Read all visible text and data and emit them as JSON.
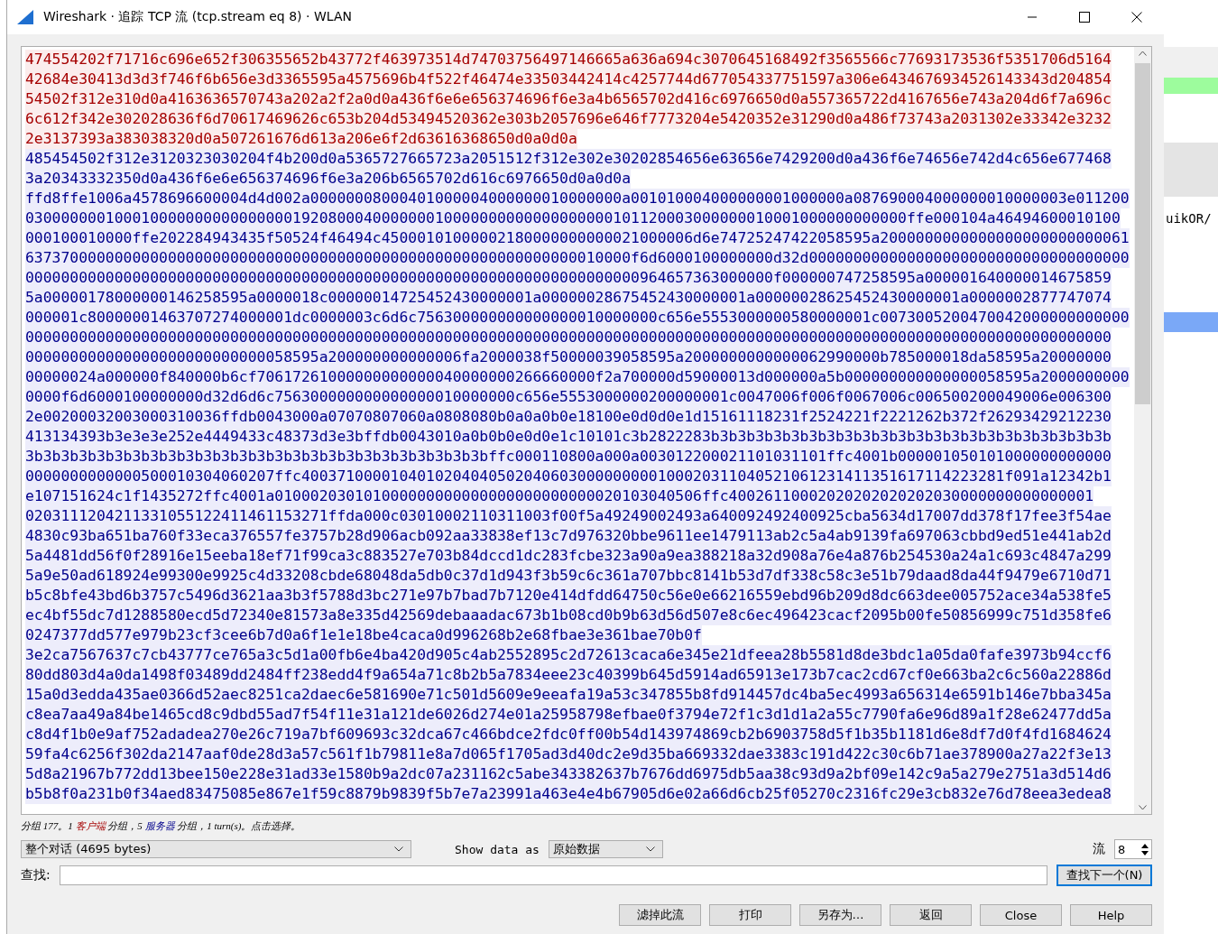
{
  "window": {
    "title": "Wireshark · 追踪 TCP 流 (tcp.stream eq 8) · WLAN"
  },
  "background_window": {
    "text": "uikOR/"
  },
  "stream": [
    {
      "kind": "client",
      "lines": [
        "474554202f71716c696e652f306355652b43772f463973514d74703756497146665a636a694c3070645168492f3565566c77693173536f5351706d5164",
        "42684e30413d3d3f746f6b656e3d3365595a4575696b4f522f46474e33503442414c4257744d677054337751597a306e6434676934526143343d204854",
        "54502f312e310d0a4163636570743a202a2f2a0d0a436f6e6e656374696f6e3a4b6565702d416c6976650d0a557365722d4167656e743a204d6f7a696c",
        "6c612f342e302028636f6d70617469626c653b204d53494520362e303b2057696e646f7773204e5420352e31290d0a486f73743a2031302e33342e3232",
        "2e3137393a383038320d0a507261676d613a206e6f2d63616368650d0a0d0a"
      ]
    },
    {
      "kind": "server",
      "lines": [
        "485454502f312e3120323030204f4b200d0a5365727665723a2051512f312e302e30202854656e63656e7429200d0a436f6e74656e742d4c656e677468",
        "3a20343332350d0a436f6e6e656374696f6e3a206b6565702d616c6976650d0a0d0a"
      ]
    },
    {
      "kind": "server",
      "lines": [
        "ffd8ffe1006a4578696600004d4d002a00000008000401000004000000010000000a001010004000000001000000a087690004000000010000003e011200",
        "030000000100010000000000000000192080004000000010000000000000000000101120003000000010001000000000000ffe000104a46494600010100",
        "000100010000ffe202284943435f50524f46494c45000101000002180000000000021000006d6e74725247422058595a2000000000000000000000000061",
        "63737000000000000000000000000000000000000000000000000000000000010000f6d6000100000000d32d000000000000000000000000000000000000",
        "000000000000000000000000000000000000000000000000000000000000000000000964657363000000f000000747258595a000001640000014675859",
        "5a00000178000000146258595a0000018c00000014725452430000001a00000028675452430000001a00000028625452430000001a0000002877747074",
        "000001c80000001463707274000001dc0000003c6d6c756300000000000000010000000c656e5553000000580000001c0073005200470042000000000000",
        "00000000000000000000000000000000000000000000000000000000000000000000000000000000000000000000000000000000000000000000000000",
        "000000000000000000000000000058595a200000000000006fa2000038f50000039058595a2000000000000062990000b785000018da58595a20000000",
        "00000024a000000f840000b6cf70617261000000000000040000000266660000f2a700000d59000013d000000a5b000000000000000058595a2000000000",
        "0000f6d6000100000000d32d6d6c756300000000000000010000000c656e5553000000200000001c0047006f006f0067006c006500200049006e006300",
        "2e00200032003000310036ffdb0043000a07070807060a0808080b0a0a0b0e18100e0d0d0e1d15161118231f2524221f2221262b372f26293429212230",
        "413134393b3e3e3e252e4449433c48373d3e3bffdb0043010a0b0b0e0d0e1c10101c3b2822283b3b3b3b3b3b3b3b3b3b3b3b3b3b3b3b3b3b3b3b3b3b3b",
        "3b3b3b3b3b3b3b3b3b3b3b3b3b3b3b3b3b3b3b3b3b3b3b3b3b3bffc000110800a000a003012200021101031101ffc4001b000001050101000000000000",
        "0000000000000500010304060207ffc4003710000104010204040502040603000000000100020311040521061231411351617114223281f091a12342b1",
        "e107151624c1f1435272ffc4001a010002030101000000000000000000000000020103040506ffc40026110002020202020202030000000000000001",
        "0203111204211331055122411461153271ffda000c03010002110311003f00f5a49249002493a640092492400925cba5634d17007dd378f17fee3f54ae",
        "4830c93ba651ba760f33eca376557fe3757b28d906acb092aa33838ef13c7d976320bbe9611ee1479113ab2c5a4ab9139fa697063cbbd9ed51e441ab2d",
        "5a4481dd56f0f28916e15eeba18ef71f99ca3c883527e703b84dccd1dc283fcbe323a90a9ea388218a32d908a76e4a876b254530a24a1c693c4847a299",
        "5a9e50ad618924e99300e9925c4d33208cbde68048da5db0c37d1d943f3b59c6c361a707bbc8141b53d7df338c58c3e51b79daad8da44f9479e6710d71",
        "b5c8bfe43bd6b3757c5496d3621aa3b3f5788d3bc271e97b7bad7b7120e414dfdd64750c56e0e66216559ebd96b209d8dc663dee005752ace34a538fe5",
        "ec4bf55dc7d1288580ecd5d72340e81573a8e335d42569debaaadac673b1b08cd0b9b63d56d507e8c6ec496423cacf2095b00fe50856999c751d358fe6",
        "0247377dd577e979b23cf3cee6b7d0a6f1e1e18be4caca0d996268b2e68fbae3e361bae70b0f"
      ]
    },
    {
      "kind": "server",
      "lines": [
        "3e2ca7567637c7cb43777ce765a3c5d1a00fb6e4ba420d905c4ab2552895c2d72613caca6e345e21dfeea28b5581d8de3bdc1a05da0fafe3973b94ccf6",
        "80dd803d4a0da1498f03489dd2484ff238edd4f9a654a71c8b2b5a7834eee23c40399b645d5914ad65913e173b7cac2cd67cf0e663ba2c6c560a22886d",
        "15a0d3edda435ae0366d52aec8251ca2daec6e581690e71c501d5609e9eeafa19a53c347855b8fd914457dc4ba5ec4993a656314e6591b146e7bba345a",
        "c8ea7aa49a84be1465cd8c9dbd55ad7f54f11e31a121de6026d274e01a25958798efbae0f3794e72f1c3d1d1a2a55c7790fa6e96d89a1f28e62477dd5a",
        "c8d4f1b0e9af752adadea270e26c719a7bf609693c32dca67c466bdce2fdc0ff00b54d143974869cb2b6903758d5f1b35b1181d6e8df7d0f4fd1684624",
        "59fa4c6256f302da2147aaf0de28d3a57c561f1b79811e8a7d065f1705ad3d40dc2e9d35ba669332dae3383c191d422c30c6b71ae378900a27a22f3e13",
        "5d8a21967b772dd13bee150e228e31ad33e1580b9a2dc07a231162c5abe343382637b7676dd6975db5aa38c93d9a2bf09e142c9a5a279e2751a3d514d6",
        "b5b8f0a231b0f34aed83475085e867e1f59c8879b9839f5b7e7a23991a463e4e4b67905d6e02a66d6cb25f05270c2316fc29e3cb832e76d78eea3edea8"
      ]
    }
  ],
  "status": [
    {
      "kind": "plain",
      "text": "分组 177。1 "
    },
    {
      "kind": "client",
      "text": "客户端"
    },
    {
      "kind": "plain",
      "text": " 分组，5 "
    },
    {
      "kind": "server",
      "text": "服务器"
    },
    {
      "kind": "plain",
      "text": " 分组，1 turn(s)。点击选择。"
    }
  ],
  "conversation_select": {
    "value": "整个对话 (4695 bytes)"
  },
  "show_as_label": "Show data as",
  "show_as_select": {
    "value": "原始数据"
  },
  "stream_label": "流",
  "stream_spin": {
    "value": "8"
  },
  "find_label": "查找:",
  "find_next_button": "查找下一个(N)",
  "buttons": [
    "滤掉此流",
    "打印",
    "另存为…",
    "返回",
    "Close",
    "Help"
  ]
}
